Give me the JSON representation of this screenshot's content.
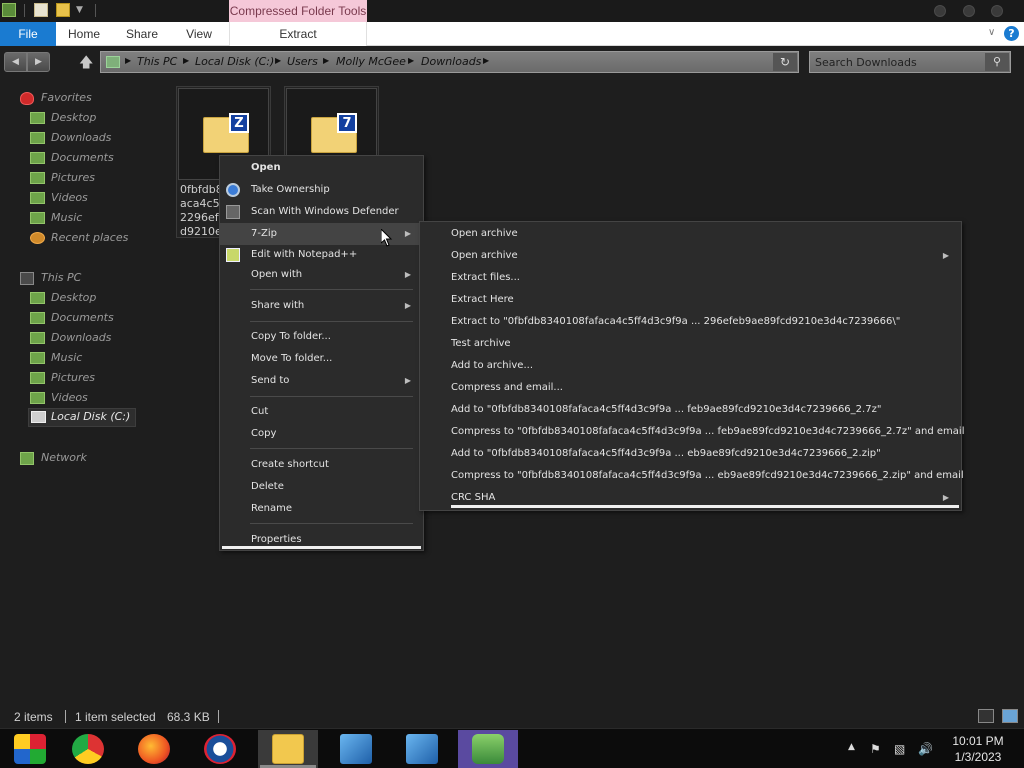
{
  "window": {
    "contextual_tab_group": "Compressed Folder Tools"
  },
  "ribbon": {
    "tabs": [
      "File",
      "Home",
      "Share",
      "View",
      "Extract"
    ],
    "accent_color": "#1a7bd1",
    "contextual_color": "#f5c8d8"
  },
  "address": {
    "breadcrumbs": [
      "This PC",
      "Local Disk (C:)",
      "Users",
      "Molly McGee",
      "Downloads"
    ]
  },
  "search": {
    "placeholder": "Search Downloads"
  },
  "navpane": {
    "favorites_header": "Favorites",
    "favorites": [
      "Desktop",
      "Downloads",
      "Documents",
      "Pictures",
      "Videos",
      "Music",
      "Recent places"
    ],
    "thispc_header": "This PC",
    "thispc": [
      "Desktop",
      "Documents",
      "Downloads",
      "Music",
      "Pictures",
      "Videos",
      "Local Disk (C:)"
    ],
    "network_header": "Network"
  },
  "files": [
    {
      "badge": "Z",
      "label": "0fbfdb8\naca4c5f\n2296efe\nd9210e"
    },
    {
      "badge": "7",
      "label": ""
    }
  ],
  "context_menu": {
    "items": [
      {
        "label": "Open",
        "bold": true
      },
      {
        "label": "Take Ownership",
        "icon": "gear-icon"
      },
      {
        "label": "Scan With Windows Defender",
        "icon": "defender-icon"
      },
      {
        "label": "7-Zip",
        "submenu": true,
        "highlighted": true
      },
      {
        "label": "Edit with Notepad++",
        "icon": "notepad-icon"
      },
      {
        "label": "Open with",
        "submenu": true
      },
      {
        "label": "Share with",
        "submenu": true
      },
      {
        "label": "Copy To folder..."
      },
      {
        "label": "Move To folder..."
      },
      {
        "label": "Send to",
        "submenu": true
      },
      {
        "label": "Cut"
      },
      {
        "label": "Copy"
      },
      {
        "label": "Create shortcut"
      },
      {
        "label": "Delete"
      },
      {
        "label": "Rename"
      },
      {
        "label": "Properties"
      }
    ]
  },
  "submenu_7zip": {
    "items": [
      {
        "label": "Open archive"
      },
      {
        "label": "Open archive",
        "submenu": true
      },
      {
        "label": "Extract files..."
      },
      {
        "label": "Extract Here"
      },
      {
        "label": "Extract to \"0fbfdb8340108fafaca4c5ff4d3c9f9a ... 296efeb9ae89fcd9210e3d4c7239666\\\""
      },
      {
        "label": "Test archive"
      },
      {
        "label": "Add to archive..."
      },
      {
        "label": "Compress and email..."
      },
      {
        "label": "Add to \"0fbfdb8340108fafaca4c5ff4d3c9f9a ... feb9ae89fcd9210e3d4c7239666_2.7z\""
      },
      {
        "label": "Compress to \"0fbfdb8340108fafaca4c5ff4d3c9f9a ... feb9ae89fcd9210e3d4c7239666_2.7z\" and email"
      },
      {
        "label": "Add to \"0fbfdb8340108fafaca4c5ff4d3c9f9a ... eb9ae89fcd9210e3d4c7239666_2.zip\""
      },
      {
        "label": "Compress to \"0fbfdb8340108fafaca4c5ff4d3c9f9a ... eb9ae89fcd9210e3d4c7239666_2.zip\" and email"
      },
      {
        "label": "CRC SHA",
        "submenu": true
      }
    ]
  },
  "status": {
    "item_count": "2 items",
    "selection": "1 item selected",
    "size": "68.3 KB"
  },
  "taskbar": {
    "apps": [
      "start",
      "chrome",
      "firefox",
      "obama",
      "explorer",
      "network-tool-1",
      "network-tool-2",
      "people"
    ],
    "time": "10:01 PM",
    "date": "1/3/2023"
  }
}
